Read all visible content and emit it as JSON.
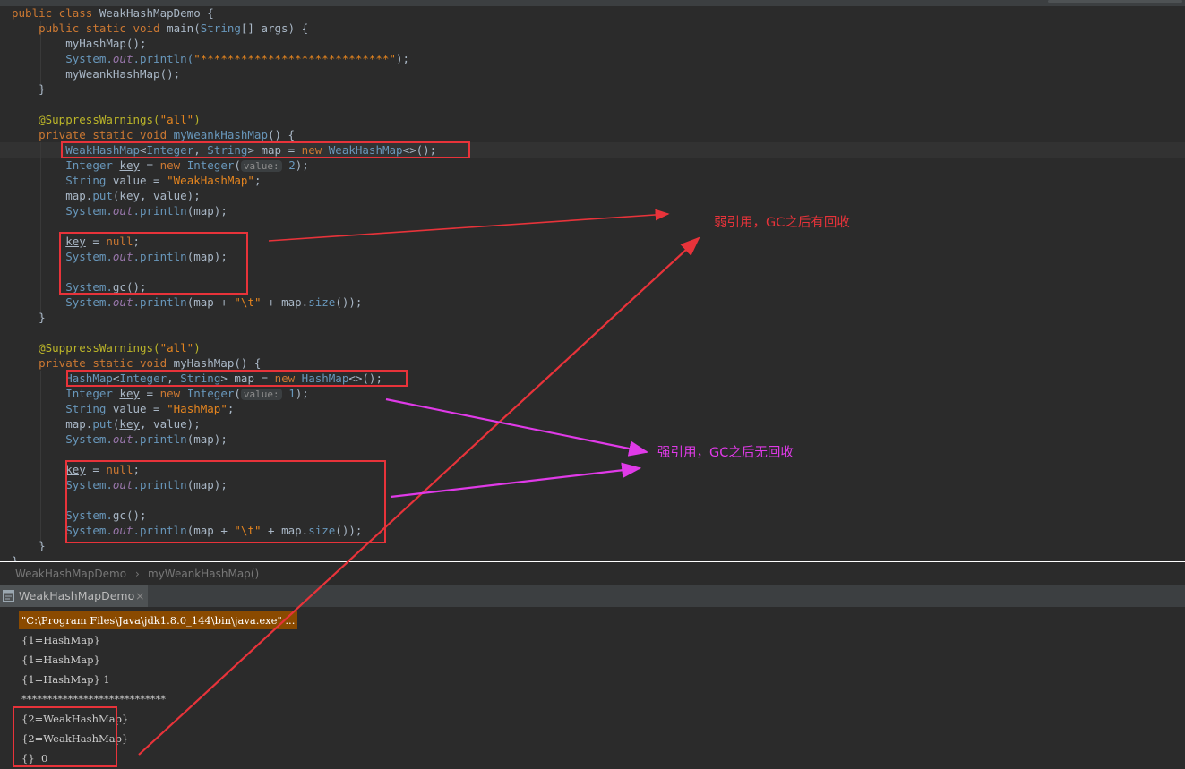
{
  "editor": {
    "lines": [
      [
        {
          "c": "kw2",
          "t": "public class "
        },
        {
          "c": "",
          "t": "WeakHashMapDemo {"
        }
      ],
      [
        {
          "c": "",
          "t": "    "
        },
        {
          "c": "kw2",
          "t": "public static void "
        },
        {
          "c": "",
          "t": "main("
        },
        {
          "c": "ty",
          "t": "String"
        },
        {
          "c": "",
          "t": "[] args) {"
        }
      ],
      [
        {
          "c": "",
          "t": "        myHashMap();"
        }
      ],
      [
        {
          "c": "",
          "t": "        "
        },
        {
          "c": "ty",
          "t": "System."
        },
        {
          "c": "fld",
          "t": "out"
        },
        {
          "c": "ty",
          "t": ".println("
        },
        {
          "c": "str2",
          "t": "\"****************************\""
        },
        {
          "c": "",
          "t": ");"
        }
      ],
      [
        {
          "c": "",
          "t": "        myWeankHashMap();"
        }
      ],
      [
        {
          "c": "",
          "t": "    }"
        }
      ],
      [
        {
          "c": "",
          "t": ""
        }
      ],
      [
        {
          "c": "",
          "t": "    "
        },
        {
          "c": "ann",
          "t": "@SuppressWarnings("
        },
        {
          "c": "str2",
          "t": "\"all\""
        },
        {
          "c": "ann",
          "t": ")"
        }
      ],
      [
        {
          "c": "",
          "t": "    "
        },
        {
          "c": "kw2",
          "t": "private static void "
        },
        {
          "c": "ty",
          "t": "myWeankHashMap"
        },
        {
          "c": "",
          "t": "() {"
        }
      ],
      [
        {
          "c": "",
          "t": "        "
        },
        {
          "c": "ty",
          "t": "WeakHashMap"
        },
        {
          "c": "",
          "t": "<"
        },
        {
          "c": "ty",
          "t": "Integer"
        },
        {
          "c": "",
          "t": ", "
        },
        {
          "c": "ty",
          "t": "String"
        },
        {
          "c": "",
          "t": "> map = "
        },
        {
          "c": "kw2",
          "t": "new "
        },
        {
          "c": "ty",
          "t": "WeakHashMap"
        },
        {
          "c": "",
          "t": "<>();"
        }
      ],
      [
        {
          "c": "",
          "t": "        "
        },
        {
          "c": "ty",
          "t": "Integer "
        },
        {
          "c": "u",
          "t": "key"
        },
        {
          "c": "",
          "t": " = "
        },
        {
          "c": "kw2",
          "t": "new "
        },
        {
          "c": "ty",
          "t": "Integer"
        },
        {
          "c": "",
          "t": "("
        },
        {
          "c": "hint",
          "t": "value:"
        },
        {
          "c": "num",
          "t": " 2"
        },
        {
          "c": "",
          "t": ");"
        }
      ],
      [
        {
          "c": "",
          "t": "        "
        },
        {
          "c": "ty",
          "t": "String "
        },
        {
          "c": "",
          "t": "value = "
        },
        {
          "c": "str2",
          "t": "\"WeakHashMap\""
        },
        {
          "c": "",
          "t": ";"
        }
      ],
      [
        {
          "c": "",
          "t": "        map."
        },
        {
          "c": "ty",
          "t": "put"
        },
        {
          "c": "",
          "t": "("
        },
        {
          "c": "u",
          "t": "key"
        },
        {
          "c": "",
          "t": ", value);"
        }
      ],
      [
        {
          "c": "",
          "t": "        "
        },
        {
          "c": "ty",
          "t": "System."
        },
        {
          "c": "fld",
          "t": "out"
        },
        {
          "c": "ty",
          "t": ".println"
        },
        {
          "c": "",
          "t": "(map);"
        }
      ],
      [
        {
          "c": "",
          "t": ""
        }
      ],
      [
        {
          "c": "",
          "t": "        "
        },
        {
          "c": "u",
          "t": "key"
        },
        {
          "c": "",
          "t": " = "
        },
        {
          "c": "kw2",
          "t": "null"
        },
        {
          "c": "",
          "t": ";"
        }
      ],
      [
        {
          "c": "",
          "t": "        "
        },
        {
          "c": "ty",
          "t": "System."
        },
        {
          "c": "fld",
          "t": "out"
        },
        {
          "c": "ty",
          "t": ".println"
        },
        {
          "c": "",
          "t": "(map);"
        }
      ],
      [
        {
          "c": "",
          "t": ""
        }
      ],
      [
        {
          "c": "",
          "t": "        "
        },
        {
          "c": "ty",
          "t": "System."
        },
        {
          "c": "",
          "t": "gc();"
        }
      ],
      [
        {
          "c": "",
          "t": "        "
        },
        {
          "c": "ty",
          "t": "System."
        },
        {
          "c": "fld",
          "t": "out"
        },
        {
          "c": "ty",
          "t": ".println"
        },
        {
          "c": "",
          "t": "(map + "
        },
        {
          "c": "str2",
          "t": "\"\\t\""
        },
        {
          "c": "",
          "t": " + map."
        },
        {
          "c": "ty",
          "t": "size"
        },
        {
          "c": "",
          "t": "());"
        }
      ],
      [
        {
          "c": "",
          "t": "    }"
        }
      ],
      [
        {
          "c": "",
          "t": ""
        }
      ],
      [
        {
          "c": "",
          "t": "    "
        },
        {
          "c": "ann",
          "t": "@SuppressWarnings("
        },
        {
          "c": "str2",
          "t": "\"all\""
        },
        {
          "c": "ann",
          "t": ")"
        }
      ],
      [
        {
          "c": "",
          "t": "    "
        },
        {
          "c": "kw2",
          "t": "private static void "
        },
        {
          "c": "",
          "t": "myHashMap() {"
        }
      ],
      [
        {
          "c": "",
          "t": "        "
        },
        {
          "c": "ty",
          "t": "HashMap"
        },
        {
          "c": "",
          "t": "<"
        },
        {
          "c": "ty",
          "t": "Integer"
        },
        {
          "c": "",
          "t": ", "
        },
        {
          "c": "ty",
          "t": "String"
        },
        {
          "c": "",
          "t": "> map = "
        },
        {
          "c": "kw2",
          "t": "new "
        },
        {
          "c": "ty",
          "t": "HashMap"
        },
        {
          "c": "",
          "t": "<>();"
        }
      ],
      [
        {
          "c": "",
          "t": "        "
        },
        {
          "c": "ty",
          "t": "Integer "
        },
        {
          "c": "u",
          "t": "key"
        },
        {
          "c": "",
          "t": " = "
        },
        {
          "c": "kw2",
          "t": "new "
        },
        {
          "c": "ty",
          "t": "Integer"
        },
        {
          "c": "",
          "t": "("
        },
        {
          "c": "hint",
          "t": "value:"
        },
        {
          "c": "num",
          "t": " 1"
        },
        {
          "c": "",
          "t": ");"
        }
      ],
      [
        {
          "c": "",
          "t": "        "
        },
        {
          "c": "ty",
          "t": "String "
        },
        {
          "c": "",
          "t": "value = "
        },
        {
          "c": "str2",
          "t": "\"HashMap\""
        },
        {
          "c": "",
          "t": ";"
        }
      ],
      [
        {
          "c": "",
          "t": "        map."
        },
        {
          "c": "ty",
          "t": "put"
        },
        {
          "c": "",
          "t": "("
        },
        {
          "c": "u",
          "t": "key"
        },
        {
          "c": "",
          "t": ", value);"
        }
      ],
      [
        {
          "c": "",
          "t": "        "
        },
        {
          "c": "ty",
          "t": "System."
        },
        {
          "c": "fld",
          "t": "out"
        },
        {
          "c": "ty",
          "t": ".println"
        },
        {
          "c": "",
          "t": "(map);"
        }
      ],
      [
        {
          "c": "",
          "t": ""
        }
      ],
      [
        {
          "c": "",
          "t": "        "
        },
        {
          "c": "u",
          "t": "key"
        },
        {
          "c": "",
          "t": " = "
        },
        {
          "c": "kw2",
          "t": "null"
        },
        {
          "c": "",
          "t": ";"
        }
      ],
      [
        {
          "c": "",
          "t": "        "
        },
        {
          "c": "ty",
          "t": "System."
        },
        {
          "c": "fld",
          "t": "out"
        },
        {
          "c": "ty",
          "t": ".println"
        },
        {
          "c": "",
          "t": "(map);"
        }
      ],
      [
        {
          "c": "",
          "t": ""
        }
      ],
      [
        {
          "c": "",
          "t": "        "
        },
        {
          "c": "ty",
          "t": "System."
        },
        {
          "c": "",
          "t": "gc();"
        }
      ],
      [
        {
          "c": "",
          "t": "        "
        },
        {
          "c": "ty",
          "t": "System."
        },
        {
          "c": "fld",
          "t": "out"
        },
        {
          "c": "ty",
          "t": ".println"
        },
        {
          "c": "",
          "t": "(map + "
        },
        {
          "c": "str2",
          "t": "\"\\t\""
        },
        {
          "c": "",
          "t": " + map."
        },
        {
          "c": "ty",
          "t": "size"
        },
        {
          "c": "",
          "t": "());"
        }
      ],
      [
        {
          "c": "",
          "t": "    }"
        }
      ],
      [
        {
          "c": "",
          "t": "}"
        }
      ]
    ]
  },
  "breadcrumb": {
    "class_name": "WeakHashMapDemo",
    "separator": "›",
    "method_name": "myWeankHashMap()"
  },
  "run_panel": {
    "tab_label": "WeakHashMapDemo",
    "close_glyph": "×",
    "output": [
      "\"C:\\Program Files\\Java\\jdk1.8.0_144\\bin\\java.exe\" ...",
      "{1=HashMap}",
      "{1=HashMap}",
      "{1=HashMap} 1",
      "****************************",
      "{2=WeakHashMap}",
      "{2=WeakHashMap}",
      "{}  0"
    ]
  },
  "annotations": {
    "weak_note": "弱引用，GC之后有回收",
    "strong_note": "强引用，GC之后无回收",
    "weak_color": "#e8333a",
    "strong_color": "#e03ae8"
  }
}
